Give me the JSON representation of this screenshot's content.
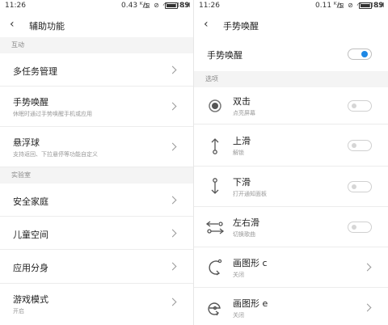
{
  "left": {
    "status": {
      "time": "11:26",
      "rate": "0.43 ᴷ/s",
      "icons": "◫ ⊘ ◠ .ıl .ıl",
      "battery": "89"
    },
    "title": "辅助功能",
    "sections": {
      "interaction": "互动",
      "lab": "实验室"
    },
    "items": {
      "multitask": {
        "label": "多任务管理"
      },
      "gesture": {
        "label": "手势唤醒",
        "sub": "休眠时通过手势唤醒手机或应用"
      },
      "floatball": {
        "label": "悬浮球",
        "sub": "支持返回、下拉悬停等功能自定义"
      },
      "safe_family": {
        "label": "安全家庭"
      },
      "kids_space": {
        "label": "儿童空间"
      },
      "app_clone": {
        "label": "应用分身"
      },
      "game_mode": {
        "label": "游戏模式",
        "sub": "开启"
      }
    }
  },
  "right": {
    "status": {
      "time": "11:26",
      "rate": "0.11 ᴷ/s",
      "icons": "◫ ⊘ ◠ .ıl .ıl",
      "battery": "89"
    },
    "title": "手势唤醒",
    "master": {
      "label": "手势唤醒",
      "enabled": true
    },
    "section_options": "选项",
    "options": {
      "double_tap": {
        "label": "双击",
        "sub": "点亮屏幕",
        "enabled": false
      },
      "swipe_up": {
        "label": "上滑",
        "sub": "解锁",
        "enabled": false
      },
      "swipe_down": {
        "label": "下滑",
        "sub": "打开通知面板",
        "enabled": false
      },
      "swipe_lr": {
        "label": "左右滑",
        "sub": "切换歌曲",
        "enabled": false
      },
      "draw_c": {
        "label": "画图形 c",
        "sub": "关闭"
      },
      "draw_e": {
        "label": "画图形 e",
        "sub": "关闭"
      }
    },
    "accent_color": "#1e88e5"
  }
}
